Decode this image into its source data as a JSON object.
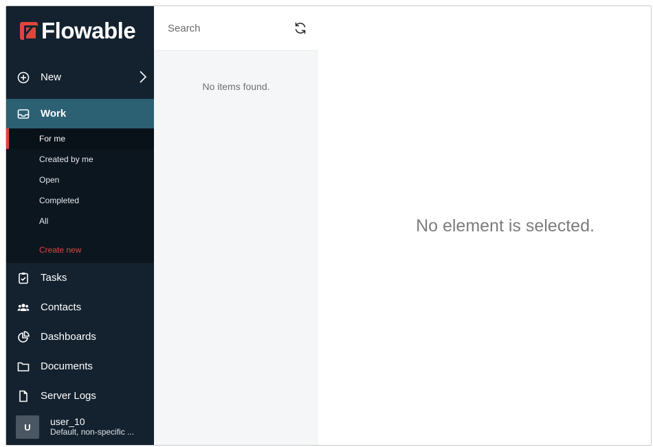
{
  "app": {
    "logo_text": "Flowable"
  },
  "sidebar": {
    "new_label": "New",
    "work_label": "Work",
    "work_items": [
      "For me",
      "Created by me",
      "Open",
      "Completed",
      "All"
    ],
    "create_new_label": "Create new",
    "tasks_label": "Tasks",
    "contacts_label": "Contacts",
    "dashboards_label": "Dashboards",
    "documents_label": "Documents",
    "server_logs_label": "Server Logs"
  },
  "user": {
    "initial": "U",
    "name": "user_10",
    "subtitle": "Default, non-specific ..."
  },
  "list": {
    "search_placeholder": "Search",
    "empty_text": "No items found."
  },
  "detail": {
    "empty_text": "No element is selected."
  },
  "colors": {
    "sidebar_bg": "#14222f",
    "active_nav_bg": "#2c6173",
    "accent_red": "#e0453b"
  }
}
